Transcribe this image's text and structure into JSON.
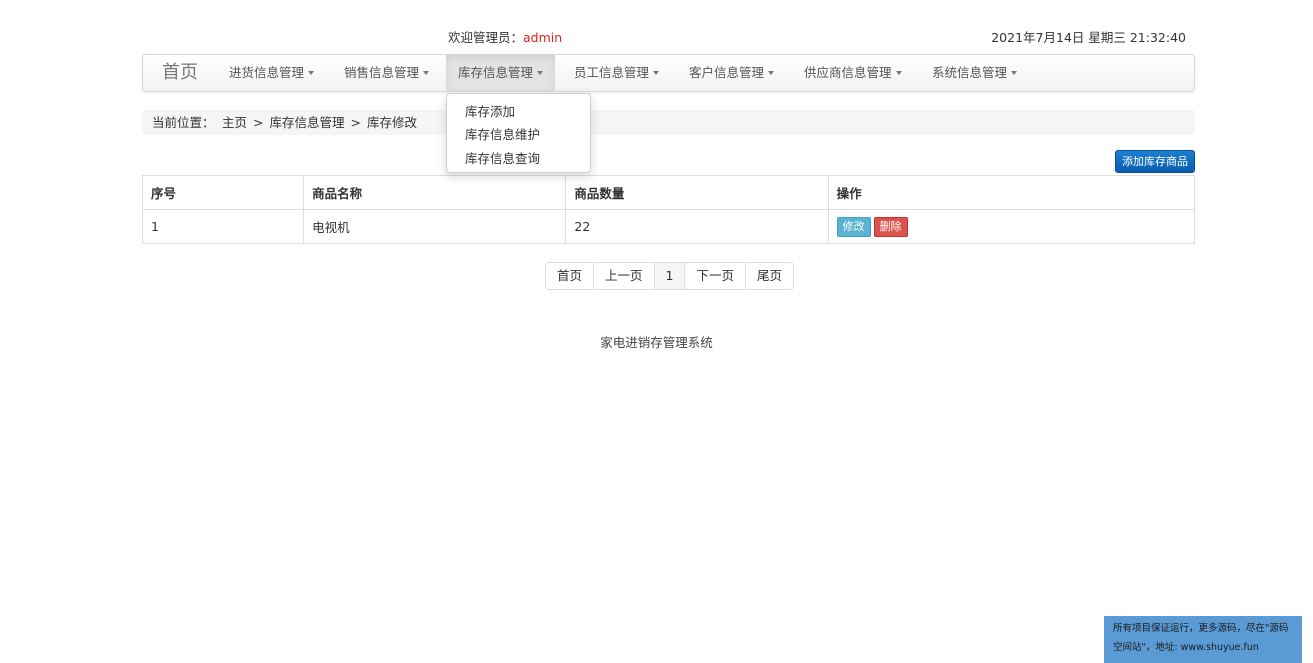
{
  "header": {
    "welcome_prefix": "欢迎管理员：",
    "welcome_user": "admin",
    "datetime": "2021年7月14日 星期三 21:32:40"
  },
  "navbar": {
    "brand": "首页",
    "items": [
      {
        "label": "进货信息管理"
      },
      {
        "label": "销售信息管理"
      },
      {
        "label": "库存信息管理"
      },
      {
        "label": "员工信息管理"
      },
      {
        "label": "客户信息管理"
      },
      {
        "label": "供应商信息管理"
      },
      {
        "label": "系统信息管理"
      }
    ],
    "active_index": 2
  },
  "dropdown": {
    "items": [
      "库存添加",
      "库存信息维护",
      "库存信息查询"
    ]
  },
  "breadcrumb": {
    "label": "当前位置：",
    "items": [
      "主页",
      "库存信息管理",
      "库存修改"
    ],
    "separator": ">"
  },
  "add_button": "添加库存商品",
  "table": {
    "headers": [
      "序号",
      "商品名称",
      "商品数量",
      "操作"
    ],
    "rows": [
      {
        "id": "1",
        "name": "电视机",
        "quantity": "22"
      }
    ],
    "edit_label": "修改",
    "delete_label": "删除"
  },
  "pagination": {
    "first": "首页",
    "prev": "上一页",
    "current": "1",
    "next": "下一页",
    "last": "尾页"
  },
  "footer": "家电进销存管理系统",
  "promo": {
    "line1": "所有项目保证运行，更多源码，尽在\"源码",
    "line2": "空间站\"，地址: www.shuyue.fun"
  },
  "colors": {
    "admin_name": "#d9231d",
    "primary_button": "#1c7fd1",
    "edit_button": "#5bb2d3",
    "delete_button": "#d9534f",
    "promo_background": "#5b9bd5"
  }
}
